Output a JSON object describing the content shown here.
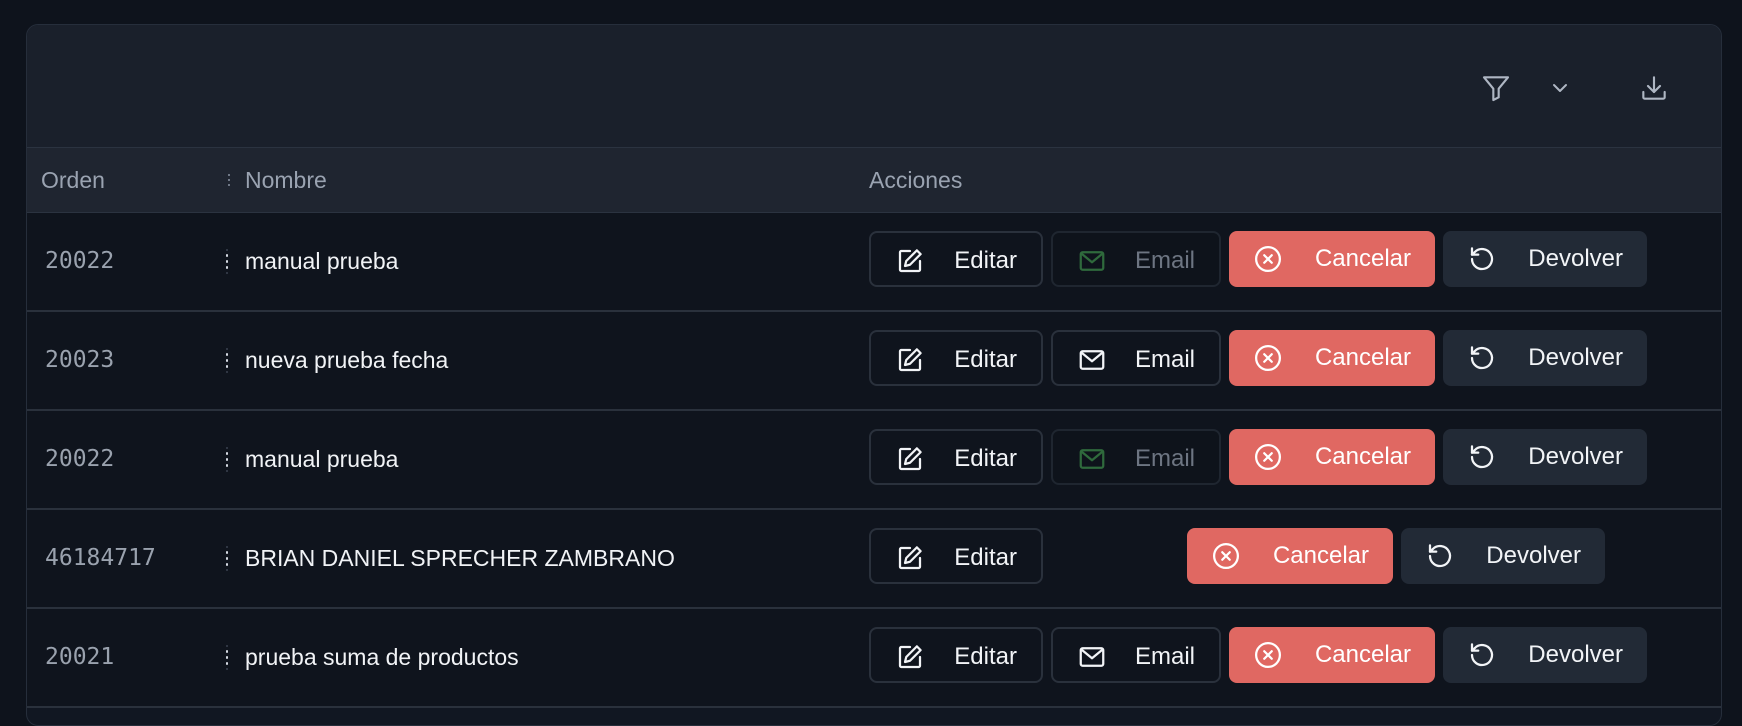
{
  "toolbar": {
    "filter_icon": "filter-icon",
    "dropdown_icon": "chevron-down-icon",
    "download_icon": "download-icon"
  },
  "table": {
    "columns": [
      "Orden",
      "Nombre",
      "Acciones"
    ],
    "rows": [
      {
        "orden": "20022",
        "nombre": "manual prueba",
        "email_enabled": false,
        "has_email": true
      },
      {
        "orden": "20023",
        "nombre": "nueva prueba fecha",
        "email_enabled": true,
        "has_email": true
      },
      {
        "orden": "20022",
        "nombre": "manual prueba",
        "email_enabled": false,
        "has_email": true
      },
      {
        "orden": "46184717",
        "nombre": "BRIAN DANIEL SPRECHER ZAMBRANO",
        "email_enabled": false,
        "has_email": false
      },
      {
        "orden": "20021",
        "nombre": "prueba suma de productos",
        "email_enabled": true,
        "has_email": true
      }
    ],
    "actions": {
      "edit_label": "Editar",
      "email_label": "Email",
      "cancel_label": "Cancelar",
      "return_label": "Devolver"
    }
  },
  "colors": {
    "background": "#0e131c",
    "cancel": "#e06862",
    "return": "#222a36",
    "email_disabled_icon": "#2f6a3c"
  }
}
